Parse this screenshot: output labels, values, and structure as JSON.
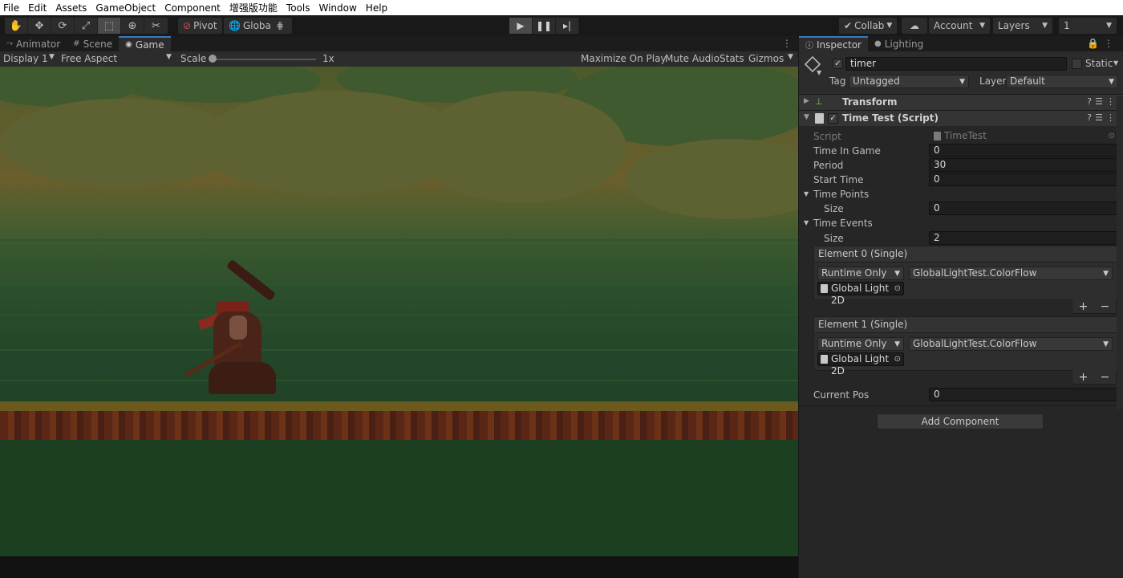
{
  "menubar": {
    "items": [
      "File",
      "Edit",
      "Assets",
      "GameObject",
      "Component",
      "增强版功能",
      "Tools",
      "Window",
      "Help"
    ]
  },
  "toolbar": {
    "tools": [
      "hand-icon",
      "move-icon",
      "rotate-icon",
      "scale-icon",
      "rect-icon",
      "transform-icon",
      "custom-tool-icon"
    ],
    "pivot_label": "Pivot",
    "global_label": "Global",
    "collab_label": "Collab",
    "account_label": "Account",
    "layers_label": "Layers",
    "layout_label": "1"
  },
  "game_panel": {
    "tabs": [
      {
        "label": "Animator",
        "icon": "animator-icon",
        "active": false
      },
      {
        "label": "Scene",
        "icon": "scene-grid-icon",
        "active": false
      },
      {
        "label": "Game",
        "icon": "gamepad-icon",
        "active": true
      }
    ],
    "display": "Display 1",
    "aspect": "Free Aspect",
    "scale_label": "Scale",
    "scale_value": "1x",
    "maximize": "Maximize On Play",
    "mute": "Mute Audio",
    "stats": "Stats",
    "gizmos": "Gizmos"
  },
  "inspector": {
    "tabs": [
      {
        "label": "Inspector",
        "icon": "info-icon"
      },
      {
        "label": "Lighting",
        "icon": "bulb-icon"
      }
    ],
    "object_name": "timer",
    "static_label": "Static",
    "tag_label": "Tag",
    "tag_value": "Untagged",
    "layer_label": "Layer",
    "layer_value": "Default",
    "transform_title": "Transform",
    "script_title": "Time Test (Script)",
    "fields": {
      "script_label": "Script",
      "script_value": "TimeTest",
      "time_in_game_label": "Time In Game",
      "time_in_game_value": "0",
      "period_label": "Period",
      "period_value": "30",
      "start_time_label": "Start Time",
      "start_time_value": "0",
      "time_points_label": "Time Points",
      "time_points_size_label": "Size",
      "time_points_size_value": "0",
      "time_events_label": "Time Events",
      "time_events_size_label": "Size",
      "time_events_size_value": "2",
      "current_pos_label": "Current Pos",
      "current_pos_value": "0"
    },
    "elements": [
      {
        "title": "Element 0 (Single)",
        "mode": "Runtime Only",
        "function": "GlobalLightTest.ColorFlow",
        "object": "Global Light 2D"
      },
      {
        "title": "Element 1 (Single)",
        "mode": "Runtime Only",
        "function": "GlobalLightTest.ColorFlow",
        "object": "Global Light 2D"
      }
    ],
    "add_component": "Add Component"
  }
}
